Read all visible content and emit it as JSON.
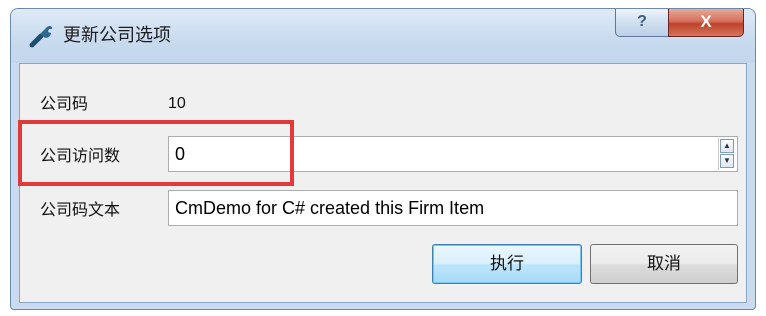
{
  "window": {
    "title": "更新公司选项",
    "help_label": "?",
    "close_label": "X"
  },
  "form": {
    "company_code_label": "公司码",
    "company_code_value": "10",
    "visit_count_label": "公司访问数",
    "visit_count_value": "0",
    "code_text_label": "公司码文本",
    "code_text_value": "CmDemo for C# created this Firm Item"
  },
  "buttons": {
    "execute_label": "执行",
    "cancel_label": "取消"
  },
  "icons": {
    "title": "wrench-icon",
    "spin_up": "spin-up-arrow",
    "spin_down": "spin-down-arrow"
  },
  "colors": {
    "highlight": "#e23a3a",
    "close_button": "#c0422b",
    "default_button_border": "#3c7fb1"
  }
}
